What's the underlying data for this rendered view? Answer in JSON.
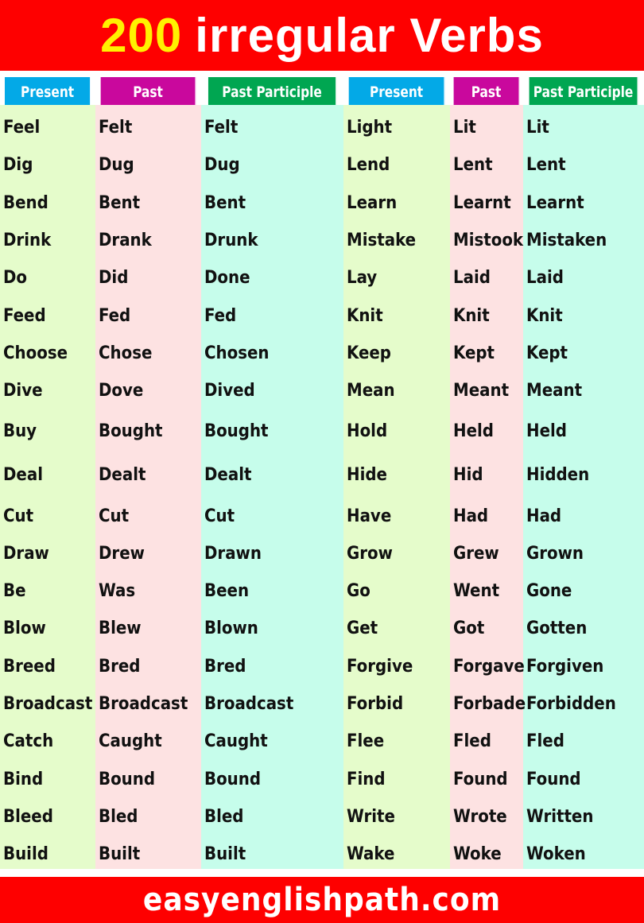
{
  "title": {
    "number": "200",
    "text": "irregular Verbs",
    "number_color": "#fff200",
    "background": "#fe0000"
  },
  "headers": [
    "Present",
    "Past",
    "Past Participle",
    "Present",
    "Past",
    "Past Participle"
  ],
  "header_colors": {
    "present": "#03a9e7",
    "past": "#c9089d",
    "past_participle": "#00a651"
  },
  "rows": [
    [
      "Feel",
      "Felt",
      "Felt",
      "Light",
      "Lit",
      "Lit"
    ],
    [
      "Dig",
      "Dug",
      "Dug",
      "Lend",
      "Lent",
      "Lent"
    ],
    [
      "Bend",
      "Bent",
      "Bent",
      "Learn",
      "Learnt",
      "Learnt"
    ],
    [
      "Drink",
      "Drank",
      "Drunk",
      "Mistake",
      "Mistook",
      "Mistaken"
    ],
    [
      "Do",
      "Did",
      "Done",
      "Lay",
      "Laid",
      "Laid"
    ],
    [
      "Feed",
      "Fed",
      "Fed",
      "Knit",
      "Knit",
      "Knit"
    ],
    [
      "Choose",
      "Chose",
      "Chosen",
      "Keep",
      "Kept",
      "Kept"
    ],
    [
      "Dive",
      "Dove",
      "Dived",
      "Mean",
      "Meant",
      "Meant"
    ],
    [
      "Buy",
      "Bought",
      "Bought",
      "Hold",
      "Held",
      "Held"
    ],
    [
      "Deal",
      "Dealt",
      "Dealt",
      "Hide",
      "Hid",
      "Hidden"
    ],
    [
      "Cut",
      "Cut",
      "Cut",
      "Have",
      "Had",
      "Had"
    ],
    [
      "Draw",
      "Drew",
      "Drawn",
      "Grow",
      "Grew",
      "Grown"
    ],
    [
      "Be",
      "Was",
      "Been",
      "Go",
      "Went",
      "Gone"
    ],
    [
      "Blow",
      "Blew",
      "Blown",
      "Get",
      "Got",
      "Gotten"
    ],
    [
      "Breed",
      "Bred",
      "Bred",
      "Forgive",
      "Forgave",
      "Forgiven"
    ],
    [
      "Broadcast",
      "Broadcast",
      "Broadcast",
      "Forbid",
      "Forbade",
      "Forbidden"
    ],
    [
      "Catch",
      "Caught",
      "Caught",
      "Flee",
      "Fled",
      "Fled"
    ],
    [
      "Bind",
      "Bound",
      "Bound",
      "Find",
      "Found",
      "Found"
    ],
    [
      "Bleed",
      "Bled",
      "Bled",
      "Write",
      "Wrote",
      "Written"
    ],
    [
      "Build",
      "Built",
      "Built",
      "Wake",
      "Woke",
      "Woken"
    ]
  ],
  "footer": {
    "text": "easyenglishpath.com"
  }
}
